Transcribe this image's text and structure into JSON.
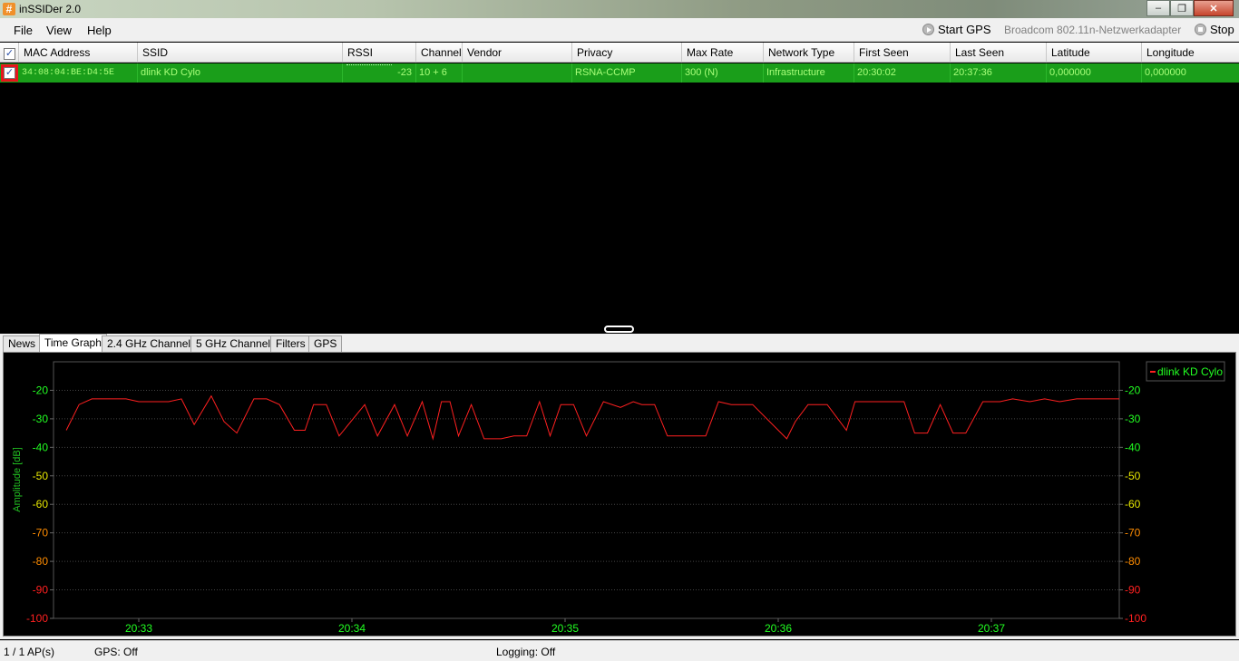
{
  "window": {
    "title": "inSSIDer 2.0",
    "app_icon_glyph": "#",
    "minimize": "–",
    "restore": "❐",
    "close": "✕"
  },
  "menu": {
    "file": "File",
    "view": "View",
    "help": "Help"
  },
  "toolbar": {
    "start_gps": "Start GPS",
    "adapter": "Broadcom 802.11n-Netzwerkadapter",
    "stop": "Stop"
  },
  "grid": {
    "header_check": "✓",
    "columns": [
      "MAC Address",
      "SSID",
      "RSSI",
      "Channel",
      "Vendor",
      "Privacy",
      "Max Rate",
      "Network Type",
      "First Seen",
      "Last Seen",
      "Latitude",
      "Longitude"
    ],
    "rows": [
      {
        "checked": "✓",
        "mac": "34:08:04:BE:D4:5E",
        "ssid": "dlink KD Cylo",
        "rssi": "-23",
        "channel": "10 + 6",
        "vendor": "",
        "privacy": "RSNA-CCMP",
        "max_rate": "300 (N)",
        "network_type": "Infrastructure",
        "first_seen": "20:30:02",
        "last_seen": "20:37:36",
        "latitude": "0,000000",
        "longitude": "0,000000"
      }
    ],
    "row_color": "#1a9e1a"
  },
  "tabs": [
    "News",
    "Time Graph",
    "2.4 GHz Channels",
    "5 GHz Channels",
    "Filters",
    "GPS"
  ],
  "active_tab": "Time Graph",
  "chart_data": {
    "type": "line",
    "ylabel": "Amplitude [dB]",
    "ylim": [
      -100,
      -10
    ],
    "yticks": [
      -20,
      -30,
      -40,
      -50,
      -60,
      -70,
      -80,
      -90,
      -100
    ],
    "x_tick_labels": [
      "20:33",
      "20:34",
      "20:35",
      "20:36",
      "20:37"
    ],
    "x_tick_minutes": [
      33,
      34,
      35,
      36,
      37
    ],
    "xlim_minutes": [
      32.6,
      37.6
    ],
    "grid": true,
    "legend_position": "top-right",
    "series": [
      {
        "name": "dlink KD Cylo",
        "color": "#ff2020",
        "x_minutes": [
          32.66,
          32.72,
          32.78,
          32.94,
          33.0,
          33.06,
          33.14,
          33.2,
          33.26,
          33.34,
          33.4,
          33.46,
          33.54,
          33.6,
          33.66,
          33.73,
          33.78,
          33.82,
          33.88,
          33.94,
          34.06,
          34.12,
          34.2,
          34.26,
          34.33,
          34.38,
          34.42,
          34.46,
          34.5,
          34.56,
          34.62,
          34.7,
          34.76,
          34.82,
          34.88,
          34.93,
          34.98,
          35.04,
          35.1,
          35.18,
          35.26,
          35.32,
          35.36,
          35.42,
          35.48,
          35.54,
          35.6,
          35.66,
          35.72,
          35.78,
          35.84,
          35.88,
          36.04,
          36.08,
          36.14,
          36.23,
          36.32,
          36.36,
          36.42,
          36.48,
          36.54,
          36.59,
          36.64,
          36.7,
          36.76,
          36.82,
          36.88,
          36.96,
          37.04,
          37.1,
          37.18,
          37.25,
          37.32,
          37.4,
          37.48,
          37.6
        ],
        "values": [
          -34,
          -25,
          -23,
          -23,
          -24,
          -24,
          -24,
          -23,
          -32,
          -22,
          -31,
          -35,
          -23,
          -23,
          -25,
          -34,
          -34,
          -25,
          -25,
          -36,
          -25,
          -36,
          -25,
          -36,
          -24,
          -37,
          -24,
          -24,
          -36,
          -25,
          -37,
          -37,
          -36,
          -36,
          -24,
          -36,
          -25,
          -25,
          -36,
          -24,
          -26,
          -24,
          -25,
          -25,
          -36,
          -36,
          -36,
          -36,
          -24,
          -25,
          -25,
          -25,
          -37,
          -31,
          -25,
          -25,
          -34,
          -24,
          -24,
          -24,
          -24,
          -24,
          -35,
          -35,
          -25,
          -35,
          -35,
          -24,
          -24,
          -23,
          -24,
          -23,
          -24,
          -23,
          -23,
          -23
        ]
      }
    ]
  },
  "status": {
    "ap_count": "1 / 1 AP(s)",
    "gps": "GPS: Off",
    "logging": "Logging: Off"
  }
}
